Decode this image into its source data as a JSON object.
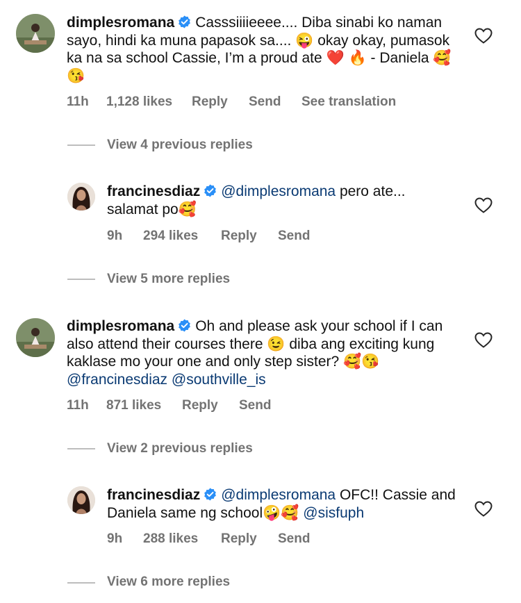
{
  "comments": [
    {
      "username": "dimplesromana",
      "text_parts": [
        "Casssiiiieeee.... Diba sinabi ko naman sayo, hindi ka muna papasok sa.... ",
        "😜",
        " okay okay, pumasok ka na sa school Cassie, I’m a proud ate ",
        "❤️",
        " ",
        "🔥",
        " - Daniela ",
        "🥰😘"
      ],
      "time": "11h",
      "likes": "1,128 likes",
      "reply": "Reply",
      "send": "Send",
      "translation": "See translation"
    },
    {
      "username": "francinesdiaz",
      "mention": "@dimplesromana",
      "text_parts": [
        " pero ate... salamat po",
        "🥰"
      ],
      "time": "9h",
      "likes": "294 likes",
      "reply": "Reply",
      "send": "Send"
    },
    {
      "username": "dimplesromana",
      "text_parts": [
        "Oh and please ask your school if I can also attend their courses there ",
        "😉",
        " diba ang exciting kung kaklase mo your one and only step sister? ",
        "🥰😘",
        " "
      ],
      "mentions": [
        "@francinesdiaz",
        "@southville_is"
      ],
      "time": "11h",
      "likes": "871 likes",
      "reply": "Reply",
      "send": "Send"
    },
    {
      "username": "francinesdiaz",
      "mention": "@dimplesromana",
      "text_parts": [
        " OFC!! Cassie and Daniela same ng school",
        "🤪🥰",
        " "
      ],
      "mention2": "@sisfuph",
      "time": "9h",
      "likes": "288 likes",
      "reply": "Reply",
      "send": "Send"
    }
  ],
  "view_rows": [
    "View 4 previous replies",
    "View 5 more replies",
    "View 2 previous replies",
    "View 6 more replies"
  ],
  "icons": {
    "verified": "verified-badge-icon",
    "heart": "heart-outline-icon"
  },
  "colors": {
    "verified": "#2a8ff7",
    "mention": "#0a3a73",
    "meta": "#737373"
  }
}
